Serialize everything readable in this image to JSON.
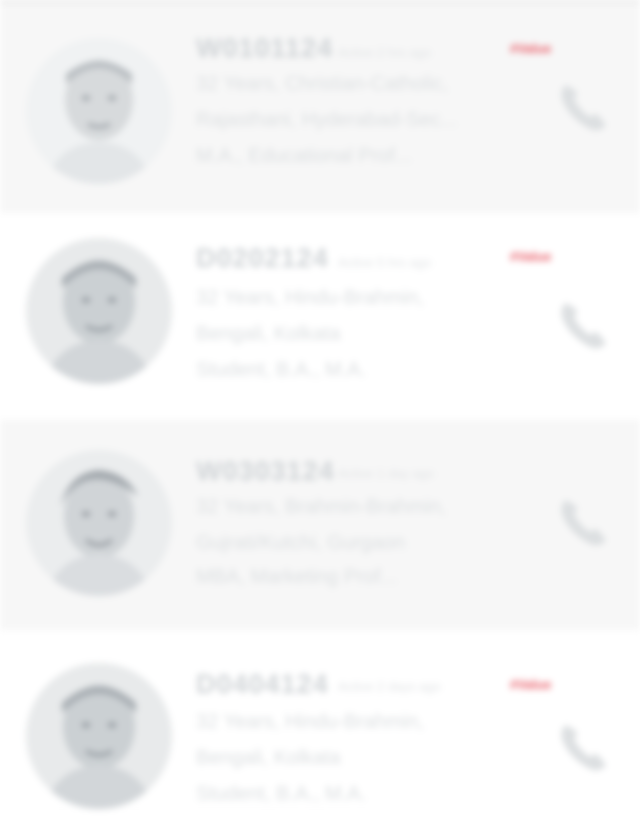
{
  "profiles": [
    {
      "id": "W0101124",
      "meta": "Active 2 hrs ago",
      "badge": "#Value",
      "line1": "32 Years, Christian-Catholic,",
      "line2": "Rajasthani, Hyderabad-Sec...",
      "line3": "M.A., Educational Prof...",
      "call_icon": "phone-icon"
    },
    {
      "id": "D0202124",
      "meta": "Active 5 hrs ago",
      "badge": "#Value",
      "line1": "32 Years, Hindu-Brahmin,",
      "line2": "Bengali, Kolkata",
      "line3": "Student, B.A., M.A.",
      "call_icon": "phone-icon"
    },
    {
      "id": "W0303124",
      "meta": "Active 1 day ago",
      "badge": "",
      "line1": "32 Years, Brahmin-Brahmin,",
      "line2": "Gujrati/Kutchi, Gurgaon",
      "line3": "MBA, Marketing Prof...",
      "call_icon": "phone-icon"
    },
    {
      "id": "D0404124",
      "meta": "Active 2 days ago",
      "badge": "#Value",
      "line1": "32 Years, Hindu-Brahmin,",
      "line2": "Bengali, Kolkata",
      "line3": "Student, B.A., M.A.",
      "call_icon": "phone-icon"
    }
  ],
  "colors": {
    "badge": "#e85b66",
    "card_shade": "#f7f7f7",
    "text": "#dcdfe1"
  }
}
